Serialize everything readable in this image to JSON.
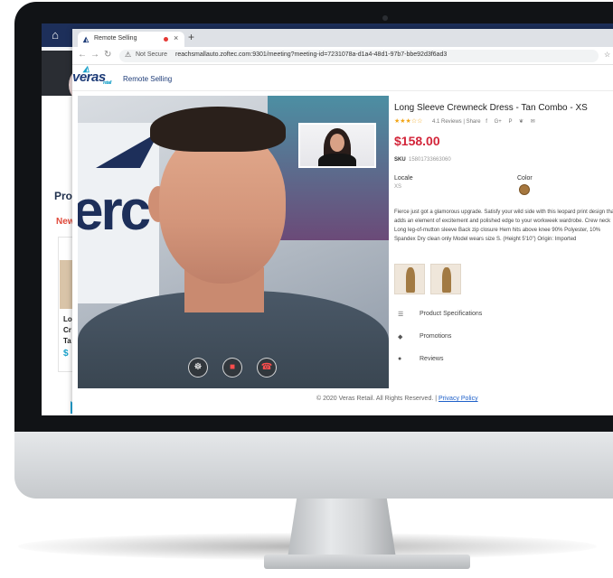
{
  "background_app": {
    "section_label": "Pro",
    "new_label": "New",
    "card_text_lines": [
      "Lo",
      "Cr",
      "Ta"
    ],
    "card_price": "$"
  },
  "browser": {
    "tab_title": "Remote Selling",
    "new_tab": "+",
    "tab_close": "×",
    "address": {
      "security_label": "Not Secure",
      "url": "reachsmallauto.zoftec.com:9301/meeting?meeting-id=7231078a-d1a4-48d1-97b7-bbe92d3f6ad3"
    }
  },
  "app": {
    "logo_text": "veras",
    "logo_sub": "retail",
    "title": "Remote Selling"
  },
  "product": {
    "title": "Long Sleeve Crewneck Dress - Tan Combo - XS",
    "stars": "★★★☆☆",
    "rating": 3,
    "reviews_text": "4.1 Reviews | Share",
    "share_icons": [
      "f",
      "G+",
      "P",
      "❦",
      "✉"
    ],
    "price": "$158.00",
    "sku_label": "SKU",
    "sku": "15801733663060",
    "locale_label": "Locale",
    "locale_value": "XS",
    "color_label": "Color",
    "description": "Fierce just got a glamorous upgrade. Satisfy your wild side with this leopard print design that adds an element of excitement and polished edge to your workweek wardrobe. Crew neck Long leg-of-mutton sleeve Back zip closure Hem hits above knee 90% Polyester, 10% Spandex Dry clean only Model wears size S. (Height 5'10\") Origin: Imported",
    "accordion": [
      {
        "icon": "☰",
        "label": "Product Specifications"
      },
      {
        "icon": "◆",
        "label": "Promotions"
      },
      {
        "icon": "●",
        "label": "Reviews"
      }
    ]
  },
  "video": {
    "controls": [
      {
        "name": "microphone",
        "glyph": "☸"
      },
      {
        "name": "camera-off",
        "glyph": "■"
      },
      {
        "name": "end-call",
        "glyph": "☎"
      }
    ]
  },
  "footer": {
    "copyright": "© 2020 Veras Retail. All Rights Reserved. |",
    "privacy": "Privacy Policy"
  },
  "colors": {
    "brand_navy": "#1d2f5a",
    "price_red": "#d3263a",
    "accent_teal": "#19a0c9"
  }
}
